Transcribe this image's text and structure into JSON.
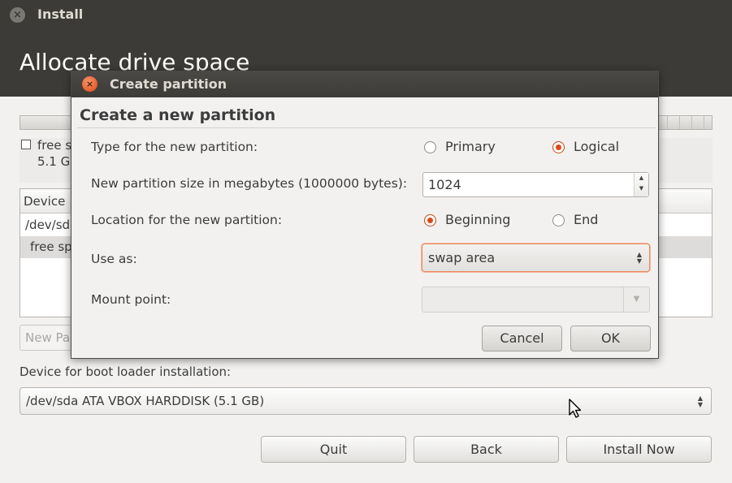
{
  "window": {
    "title": "Install",
    "heading": "Allocate drive space"
  },
  "legend": {
    "name": "free s",
    "size": "5.1 G"
  },
  "table": {
    "header": "Device",
    "rows": [
      "/dev/sd",
      "free sp"
    ]
  },
  "new_partition_button": "New Pa",
  "boot_loader": {
    "label": "Device for boot loader installation:",
    "value": "/dev/sda ATA VBOX HARDDISK (5.1 GB)"
  },
  "buttons": {
    "quit": "Quit",
    "back": "Back",
    "install_now": "Install Now"
  },
  "dialog": {
    "title": "Create partition",
    "heading": "Create a new partition",
    "type_label": "Type for the new partition:",
    "type_options": [
      {
        "label": "Primary",
        "selected": false
      },
      {
        "label": "Logical",
        "selected": true
      }
    ],
    "size_label": "New partition size in megabytes (1000000 bytes):",
    "size_value": "1024",
    "location_label": "Location for the new partition:",
    "location_options": [
      {
        "label": "Beginning",
        "selected": true
      },
      {
        "label": "End",
        "selected": false
      }
    ],
    "use_as_label": "Use as:",
    "use_as_value": "swap area",
    "mount_label": "Mount point:",
    "mount_value": "",
    "cancel": "Cancel",
    "ok": "OK"
  },
  "colors": {
    "accent": "#dd4814",
    "titlebar": "#3c3b37",
    "background": "#f2f1f0"
  },
  "icons": [
    "close-icon",
    "combo-arrows-icon",
    "spin-arrows-icon",
    "dropdown-arrow-icon",
    "mouse-pointer-icon"
  ]
}
